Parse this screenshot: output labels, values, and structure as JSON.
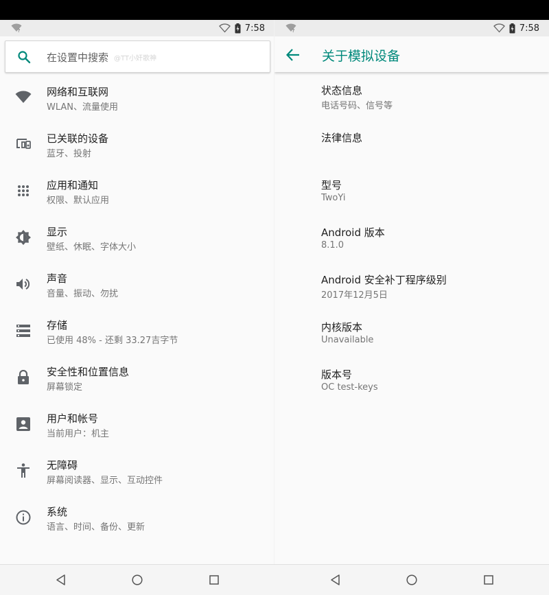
{
  "status_bar": {
    "time": "7:58"
  },
  "settings": {
    "search_placeholder": "在设置中搜索",
    "search_watermark": "@TT小奸歌神",
    "items": [
      {
        "icon": "wifi-icon",
        "title": "网络和互联网",
        "subtitle": "WLAN、流量使用"
      },
      {
        "icon": "connected-devices-icon",
        "title": "已关联的设备",
        "subtitle": "蓝牙、投射"
      },
      {
        "icon": "apps-icon",
        "title": "应用和通知",
        "subtitle": "权限、默认应用"
      },
      {
        "icon": "brightness-icon",
        "title": "显示",
        "subtitle": "壁纸、休眠、字体大小"
      },
      {
        "icon": "volume-icon",
        "title": "声音",
        "subtitle": "音量、振动、勿扰"
      },
      {
        "icon": "storage-icon",
        "title": "存储",
        "subtitle": "已使用 48% - 还剩 33.27吉字节"
      },
      {
        "icon": "lock-icon",
        "title": "安全性和位置信息",
        "subtitle": "屏幕锁定"
      },
      {
        "icon": "account-icon",
        "title": "用户和帐号",
        "subtitle": "当前用户：机主"
      },
      {
        "icon": "accessibility-icon",
        "title": "无障碍",
        "subtitle": "屏幕阅读器、显示、互动控件"
      },
      {
        "icon": "info-icon",
        "title": "系统",
        "subtitle": "语言、时间、备份、更新"
      }
    ]
  },
  "about": {
    "title": "关于模拟设备",
    "items": [
      {
        "title": "状态信息",
        "subtitle": "电话号码、信号等"
      },
      {
        "title": "法律信息",
        "subtitle": ""
      },
      {
        "title": "型号",
        "subtitle": "TwoYi"
      },
      {
        "title": "Android 版本",
        "subtitle": "8.1.0"
      },
      {
        "title": "Android 安全补丁程序级别",
        "subtitle": "2017年12月5日"
      },
      {
        "title": "内核版本",
        "subtitle": "Unavailable"
      },
      {
        "title": "版本号",
        "subtitle": "OC test-keys"
      }
    ]
  },
  "colors": {
    "accent": "#00897b",
    "icon": "#5f6368",
    "title": "#212121",
    "subtitle": "#757575"
  }
}
